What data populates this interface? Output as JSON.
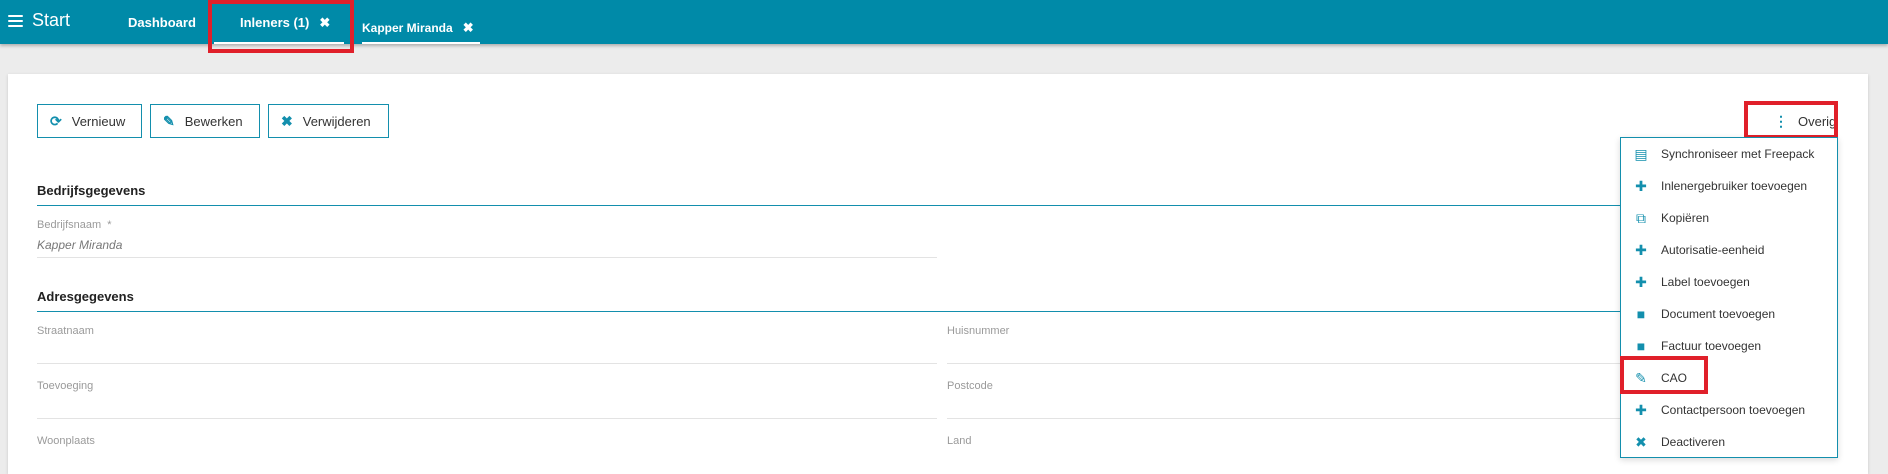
{
  "topbar": {
    "start": "Start",
    "tabs": [
      {
        "label": "Dashboard"
      },
      {
        "label": "Inleners (1)",
        "close": "✖"
      },
      {
        "label": "Kapper Miranda",
        "close": "✖"
      }
    ]
  },
  "toolbar": {
    "vernieuw": "Vernieuw",
    "bewerken": "Bewerken",
    "verwijderen": "Verwijderen",
    "overig": "Overig"
  },
  "sections": {
    "bedrijf": {
      "title": "Bedrijfsgegevens",
      "bedrijfsnaam_label": "Bedrijfsnaam",
      "required_mark": "*",
      "bedrijfsnaam_value": "Kapper Miranda"
    },
    "adres": {
      "title": "Adresgegevens",
      "straatnaam": "Straatnaam",
      "huisnummer": "Huisnummer",
      "toevoeging": "Toevoeging",
      "postcode": "Postcode",
      "woonplaats": "Woonplaats",
      "land": "Land"
    }
  },
  "menu": {
    "items": [
      {
        "label": "Synchroniseer met Freepack",
        "icon": "list-box-icon"
      },
      {
        "label": "Inlenergebruiker toevoegen",
        "icon": "plus-icon"
      },
      {
        "label": "Kopiëren",
        "icon": "copy-icon"
      },
      {
        "label": "Autorisatie-eenheid",
        "icon": "plus-icon"
      },
      {
        "label": "Label toevoegen",
        "icon": "plus-icon"
      },
      {
        "label": "Document toevoegen",
        "icon": "folder-icon"
      },
      {
        "label": "Factuur toevoegen",
        "icon": "folder-icon"
      },
      {
        "label": "CAO",
        "icon": "edit-icon"
      },
      {
        "label": "Contactpersoon toevoegen",
        "icon": "plus-icon"
      },
      {
        "label": "Deactiveren",
        "icon": "close-icon"
      }
    ]
  },
  "colors": {
    "accent": "#008aa8",
    "highlight": "#e0202a"
  }
}
